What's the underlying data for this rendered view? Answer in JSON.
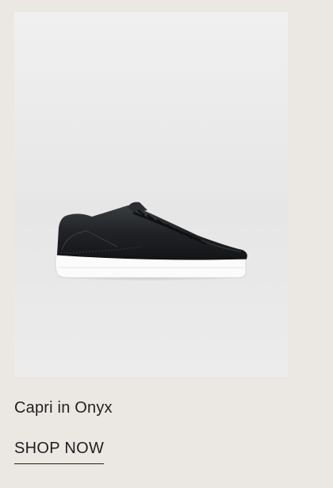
{
  "product": {
    "name": "Capri in Onyx",
    "cta_label": "SHOP NOW",
    "image_subject": "black-leather-low-top-sneaker-white-sole"
  },
  "colors": {
    "page_background": "#ebe8e4",
    "image_background": "#e9e9e9",
    "text": "#1f1f1f",
    "shoe_upper": "#1c1e21",
    "shoe_sole": "#fbfbfb"
  }
}
